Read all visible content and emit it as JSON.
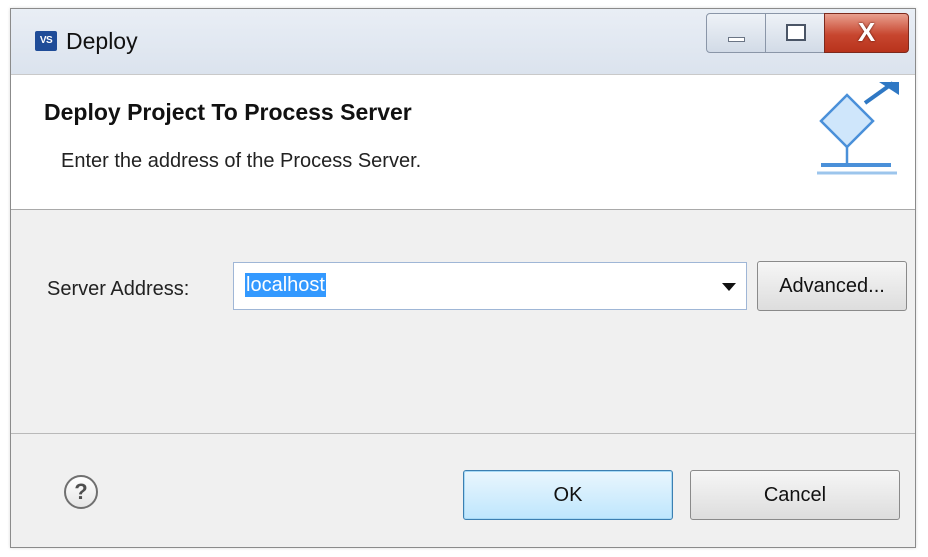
{
  "window": {
    "title": "Deploy",
    "app_icon_text": "VS",
    "controls": {
      "minimize": "minimize",
      "maximize": "maximize",
      "close_glyph": "X"
    }
  },
  "banner": {
    "title": "Deploy Project To Process Server",
    "description": "Enter the address of the Process Server.",
    "icon": "deploy-wizard-icon"
  },
  "form": {
    "server_address_label": "Server Address:",
    "server_address_value": "localhost",
    "advanced_label": "Advanced..."
  },
  "footer": {
    "help_glyph": "?",
    "ok_label": "OK",
    "cancel_label": "Cancel"
  },
  "colors": {
    "selection": "#3399ff",
    "close_button": "#c7462f",
    "default_button_border": "#3c7fb1",
    "banner_icon_blue": "#4a90d9"
  }
}
